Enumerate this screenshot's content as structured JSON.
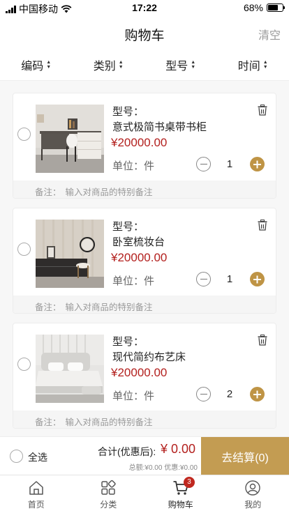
{
  "status_bar": {
    "carrier": "中国移动",
    "time": "17:22",
    "battery": "68%",
    "battery_level": 0.68
  },
  "header": {
    "title": "购物车",
    "clear_label": "清空"
  },
  "sort_tabs": [
    {
      "label": "编码"
    },
    {
      "label": "类别"
    },
    {
      "label": "型号"
    },
    {
      "label": "时间"
    }
  ],
  "cart": {
    "model_label": "型号：",
    "unit_label": "单位：",
    "note_label": "备注：",
    "note_placeholder": "输入对商品的特别备注",
    "items": [
      {
        "name": "意式极简书桌带书柜",
        "price": "¥20000.00",
        "unit": "件",
        "quantity": "1",
        "image": "desk-with-bookshelf"
      },
      {
        "name": "卧室梳妆台",
        "price": "¥20000.00",
        "unit": "件",
        "quantity": "1",
        "image": "vanity-table"
      },
      {
        "name": "现代简约布艺床",
        "price": "¥20000.00",
        "unit": "件",
        "quantity": "2",
        "image": "fabric-bed"
      }
    ]
  },
  "checkout": {
    "select_all_label": "全选",
    "total_label": "合计(优惠后):",
    "total_value": "¥ 0.00",
    "subtotal_text": "总额:¥0.00 优惠:¥0.00",
    "pay_label": "去结算(0)"
  },
  "tab_bar": {
    "tabs": [
      {
        "label": "首页",
        "icon": "home-icon"
      },
      {
        "label": "分类",
        "icon": "category-icon"
      },
      {
        "label": "购物车",
        "icon": "cart-icon",
        "badge": "3"
      },
      {
        "label": "我的",
        "icon": "user-icon"
      }
    ]
  },
  "colors": {
    "accent": "#c39c52",
    "price": "#b3201e",
    "badge": "#c0281f"
  }
}
